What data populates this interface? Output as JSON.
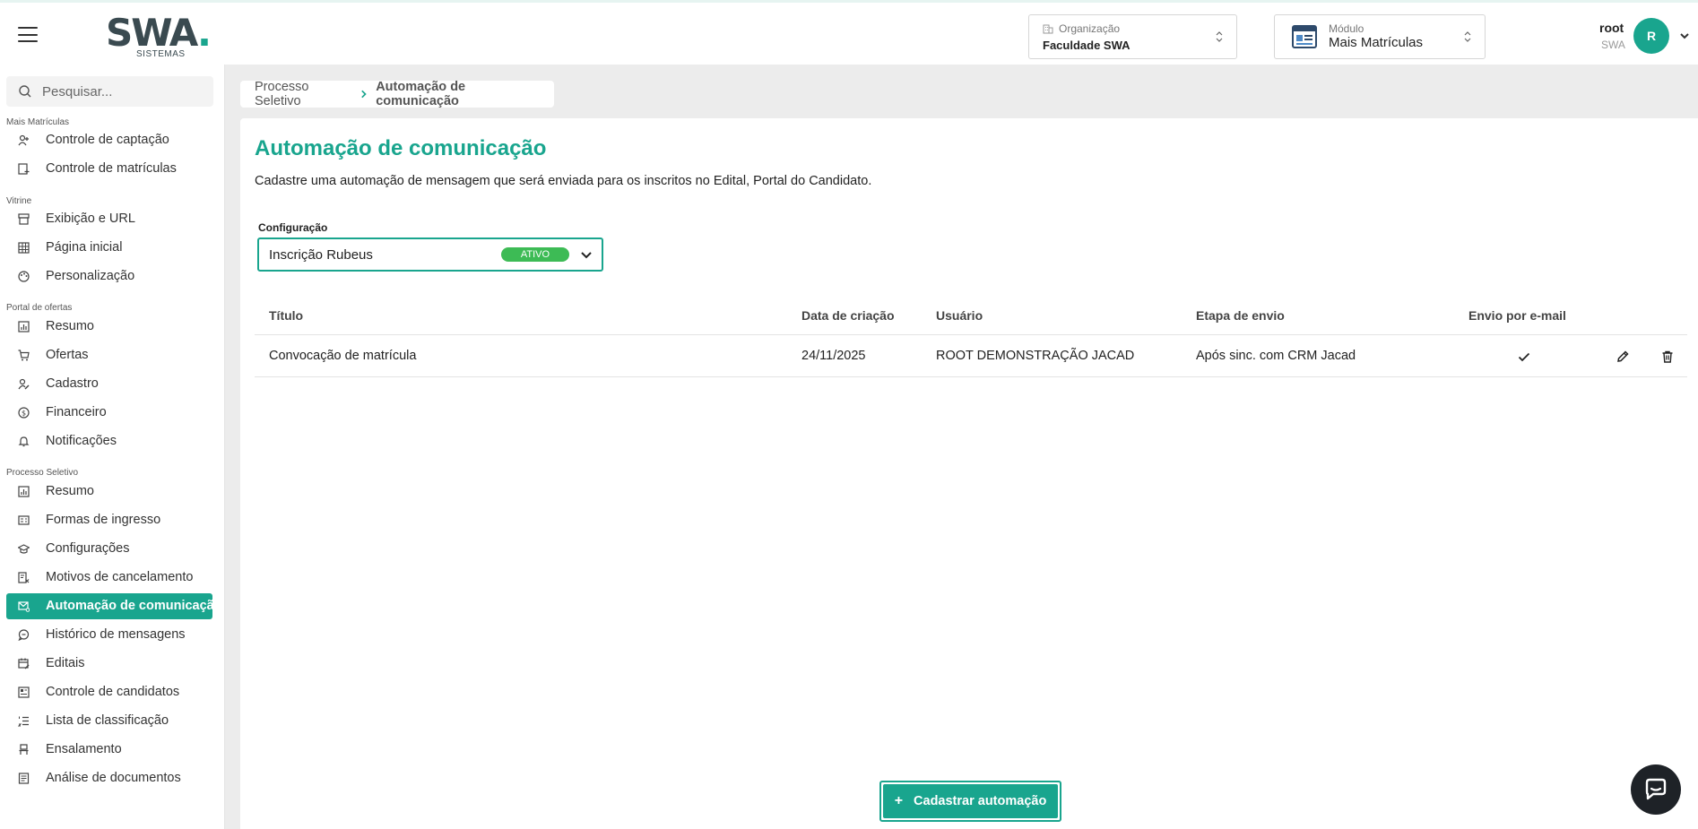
{
  "header": {
    "logo_text": "SWA",
    "logo_subtitle": "SISTEMAS",
    "organization": {
      "label": "Organização",
      "value": "Faculdade SWA"
    },
    "module": {
      "label": "Módulo",
      "value": "Mais Matrículas"
    },
    "user": {
      "name": "root",
      "org": "SWA",
      "initial": "R"
    }
  },
  "sidebar": {
    "search_placeholder": "Pesquisar...",
    "sections": [
      {
        "title": "Mais Matrículas"
      },
      {
        "title": "Vitrine"
      },
      {
        "title": "Portal de ofertas"
      },
      {
        "title": "Processo Seletivo"
      }
    ],
    "items": [
      {
        "label": "Controle de captação",
        "icon": "user-plus-icon"
      },
      {
        "label": "Controle de matrículas",
        "icon": "document-add-icon"
      },
      {
        "label": "Exibição e URL",
        "icon": "storefront-icon"
      },
      {
        "label": "Página inicial",
        "icon": "grid-icon"
      },
      {
        "label": "Personalização",
        "icon": "palette-icon"
      },
      {
        "label": "Resumo",
        "icon": "chart-icon"
      },
      {
        "label": "Ofertas",
        "icon": "cart-icon"
      },
      {
        "label": "Cadastro",
        "icon": "user-edit-icon"
      },
      {
        "label": "Financeiro",
        "icon": "dollar-circle-icon"
      },
      {
        "label": "Notificações",
        "icon": "bell-icon"
      },
      {
        "label": "Resumo",
        "icon": "chart-icon"
      },
      {
        "label": "Formas de ingresso",
        "icon": "id-card-icon"
      },
      {
        "label": "Configurações",
        "icon": "graduation-cap-icon"
      },
      {
        "label": "Motivos de cancelamento",
        "icon": "document-x-icon"
      },
      {
        "label": "Automação de comunicação",
        "icon": "mail-auto-icon"
      },
      {
        "label": "Histórico de mensagens",
        "icon": "chat-history-icon"
      },
      {
        "label": "Editais",
        "icon": "calendar-edit-icon"
      },
      {
        "label": "Controle de candidatos",
        "icon": "candidates-icon"
      },
      {
        "label": "Lista de classificação",
        "icon": "list-ordered-icon"
      },
      {
        "label": "Ensalamento",
        "icon": "seat-icon"
      },
      {
        "label": "Análise de documentos",
        "icon": "document-lines-icon"
      }
    ]
  },
  "breadcrumb": {
    "parent": "Processo Seletivo",
    "current": "Automação de comunicação"
  },
  "page": {
    "title": "Automação de comunicação",
    "description": "Cadastre uma automação de mensagem que será enviada para os inscritos no Edital, Portal do Candidato.",
    "config": {
      "label": "Configuração",
      "value": "Inscrição Rubeus",
      "badge": "ATIVO"
    }
  },
  "table": {
    "headers": [
      "Título",
      "Data de criação",
      "Usuário",
      "Etapa de envio",
      "Envio por e-mail"
    ],
    "rows": [
      {
        "titulo": "Convocação de matrícula",
        "data": "24/11/2025",
        "usuario": "ROOT DEMONSTRAÇÃO JACAD",
        "etapa": "Após sinc. com CRM Jacad",
        "email": "check"
      }
    ]
  },
  "actions": {
    "add_label": "Cadastrar automação"
  },
  "colors": {
    "accent": "#19a58e",
    "badge": "#3dbb55",
    "chat": "#1e2227"
  }
}
